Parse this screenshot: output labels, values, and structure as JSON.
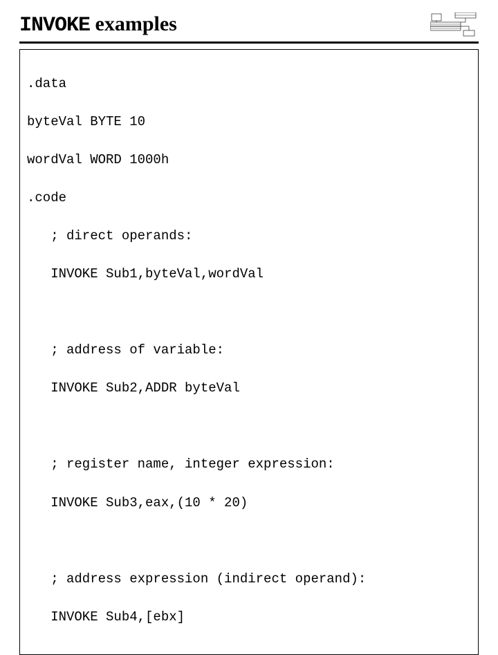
{
  "title": {
    "mono": "INVOKE",
    "rest": " examples"
  },
  "code": {
    "l1": ".data",
    "l2": "byteVal BYTE 10",
    "l3": "wordVal WORD 1000h",
    "l4": ".code",
    "l5": "; direct operands:",
    "l6": "INVOKE Sub1,byteVal,wordVal",
    "l7": "; address of variable:",
    "l8": "INVOKE Sub2,ADDR byteVal",
    "l9": "; register name, integer expression:",
    "l10": "INVOKE Sub3,eax,(10 * 20)",
    "l11": "; address expression (indirect operand):",
    "l12": "INVOKE Sub4,[ebx]"
  }
}
